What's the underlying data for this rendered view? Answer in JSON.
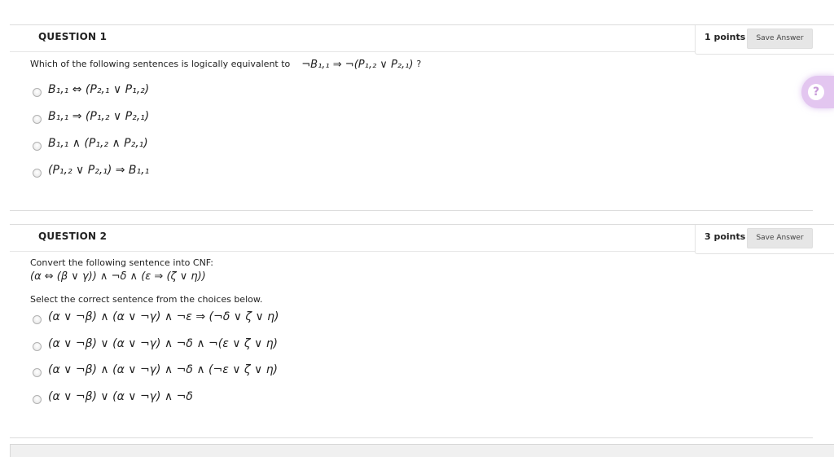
{
  "questions": [
    {
      "title": "QUESTION 1",
      "points": "1 points",
      "save_label": "Save Answer",
      "prompt_text": "Which of the following sentences is logically equivalent to",
      "prompt_math": "¬B₁,₁ ⇒ ¬(P₁,₂ ∨ P₂,₁)",
      "prompt_tail": "?",
      "choices": [
        "B₁,₁ ⇔ (P₂,₁ ∨ P₁,₂)",
        "B₁,₁ ⇒ (P₁,₂ ∨ P₂,₁)",
        "B₁,₁ ∧ (P₁,₂ ∧ P₂,₁)",
        "(P₁,₂ ∨ P₂,₁) ⇒ B₁,₁"
      ]
    },
    {
      "title": "QUESTION 2",
      "points": "3 points",
      "save_label": "Save Answer",
      "prompt_text": "Convert the following sentence into CNF:",
      "prompt_math": "(α ⇔ (β ∨ γ)) ∧ ¬δ ∧ (ε ⇒ (ζ ∨ η))",
      "instruction": "Select the correct sentence from the choices below.",
      "choices": [
        "(α ∨ ¬β) ∧ (α ∨ ¬γ) ∧ ¬ε ⇒ (¬δ ∨ ζ ∨ η)",
        "(α ∨ ¬β) ∨ (α ∨ ¬γ) ∧ ¬δ ∧ ¬(ε ∨ ζ ∨ η)",
        "(α ∨ ¬β) ∧ (α ∨ ¬γ) ∧ ¬δ ∧ (¬ε ∨ ζ ∨ η)",
        "(α ∨ ¬β) ∨ (α ∨ ¬γ) ∧ ¬δ"
      ]
    }
  ],
  "help_icon": "question-mark-icon",
  "colors": {
    "help_bg": "#e3c6f0",
    "button_bg": "#e6e6e6",
    "divider": "#dcdcdc"
  }
}
